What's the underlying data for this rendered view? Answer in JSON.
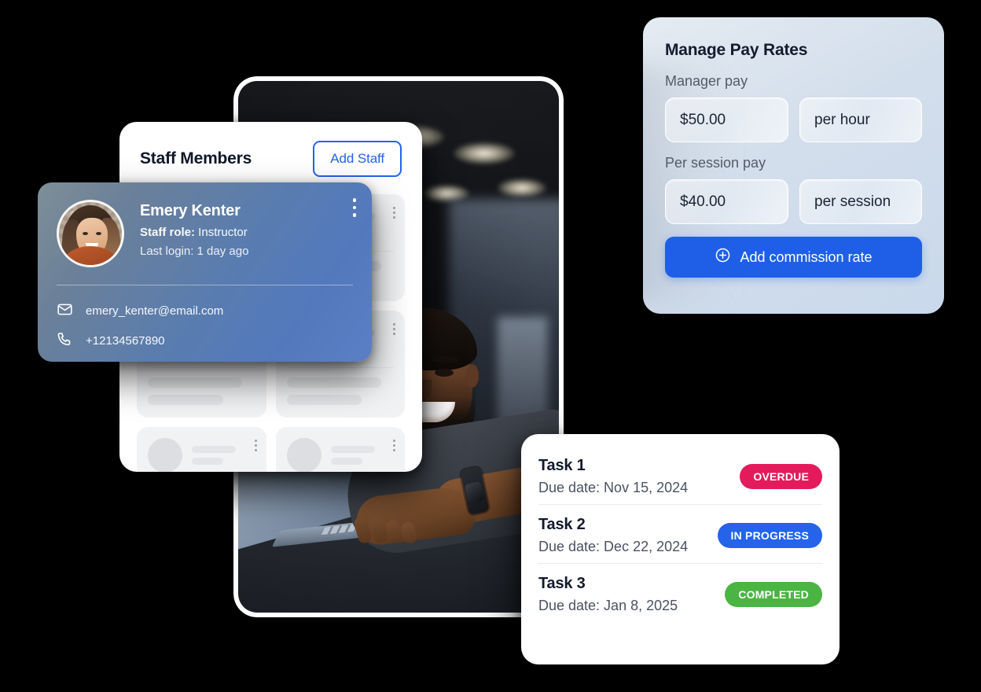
{
  "staff_list": {
    "title": "Staff Members",
    "add_button": "Add Staff",
    "skeleton_items": 6
  },
  "staff_card": {
    "name": "Emery Kenter",
    "role_label": "Staff role:",
    "role_value": " Instructor",
    "last_login": "Last login: 1 day ago",
    "email": "emery_kenter@email.com",
    "phone": "+12134567890",
    "menu_icon": "kebab-menu-icon",
    "email_icon": "envelope-icon",
    "phone_icon": "phone-icon",
    "gradient_from": "#7e8f98",
    "gradient_to": "#5b7fc4"
  },
  "pay_rates": {
    "title": "Manage Pay Rates",
    "manager_pay_label": "Manager pay",
    "manager_pay_amount": "$50.00",
    "manager_pay_unit": "per hour",
    "session_pay_label": "Per session pay",
    "session_pay_amount": "$40.00",
    "session_pay_unit": "per session",
    "commission_button": "Add commission rate",
    "commission_icon": "plus-circle-icon",
    "accent_color": "#1f5fe8"
  },
  "tasks": {
    "items": [
      {
        "title": "Task 1",
        "due": "Due date: Nov 15, 2024",
        "status": "OVERDUE",
        "status_color": "#e31b5d"
      },
      {
        "title": "Task 2",
        "due": "Due date: Dec 22, 2024",
        "status": "IN PROGRESS",
        "status_color": "#2563eb"
      },
      {
        "title": "Task 3",
        "due": "Due date: Jan 8, 2025",
        "status": "COMPLETED",
        "status_color": "#4bb543"
      }
    ]
  },
  "photo": {
    "alt": "smiling-fitness-trainer-at-laptop-in-gym"
  }
}
